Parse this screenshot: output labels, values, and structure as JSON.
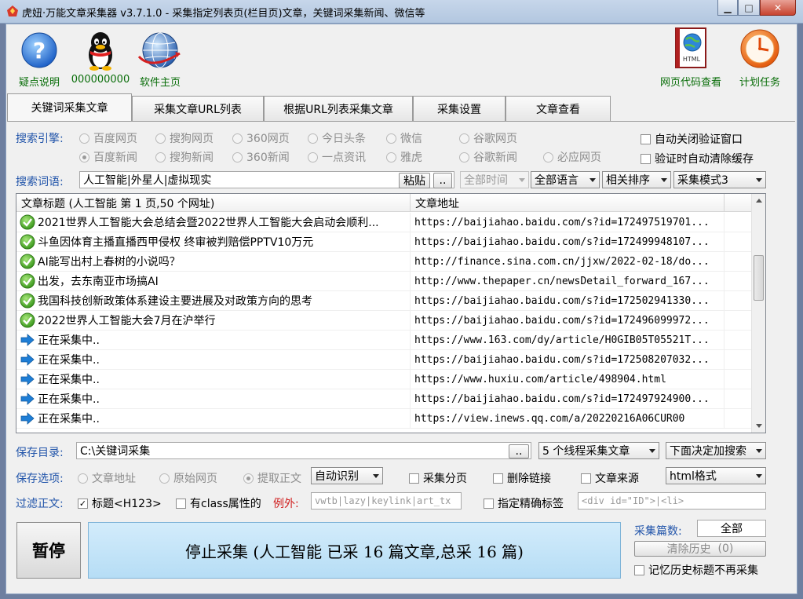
{
  "window": {
    "title": "虎妞·万能文章采集器 v3.7.1.0 - 采集指定列表页(栏目页)文章，关键词采集新闻、微信等"
  },
  "toolbar": {
    "left": [
      {
        "label": "疑点说明",
        "icon": "help-icon"
      },
      {
        "label": "000000000",
        "icon": "qq-penguin-icon"
      },
      {
        "label": "软件主页",
        "icon": "globe-icon"
      }
    ],
    "right": [
      {
        "label": "网页代码查看",
        "icon": "html-file-icon"
      },
      {
        "label": "计划任务",
        "icon": "clock-icon"
      }
    ]
  },
  "tabs": [
    "关键词采集文章",
    "采集文章URL列表",
    "根据URL列表采集文章",
    "采集设置",
    "文章查看"
  ],
  "engines": {
    "label": "搜索引擎:",
    "row1": [
      "百度网页",
      "搜狗网页",
      "360网页",
      "今日头条",
      "微信",
      "谷歌网页"
    ],
    "row2": [
      "百度新闻",
      "搜狗新闻",
      "360新闻",
      "一点资讯",
      "雅虎",
      "谷歌新闻",
      "必应网页"
    ],
    "options": [
      "自动关闭验证窗口",
      "验证时自动清除缓存"
    ]
  },
  "search": {
    "label": "搜索词语:",
    "value": "人工智能|外星人|虚拟现实",
    "paste": "粘贴",
    "more": "..",
    "time": "全部时间",
    "lang": "全部语言",
    "sort": "相关排序",
    "mode": "采集模式3"
  },
  "table": {
    "col_title": "文章标题 (人工智能 第 1 页,50 个网址)",
    "col_url": "文章地址",
    "rows": [
      {
        "status": "done",
        "title": "2021世界人工智能大会总结会暨2022世界人工智能大会启动会顺利...",
        "url": "https://baijiahao.baidu.com/s?id=172497519701..."
      },
      {
        "status": "done",
        "title": "斗鱼因体育主播直播西甲侵权 终审被判赔偿PPTV10万元",
        "url": "https://baijiahao.baidu.com/s?id=172499948107..."
      },
      {
        "status": "done",
        "title": "AI能写出村上春树的小说吗？",
        "url": "http://finance.sina.com.cn/jjxw/2022-02-18/do..."
      },
      {
        "status": "done",
        "title": "出发，去东南亚市场搞AI",
        "url": "http://www.thepaper.cn/newsDetail_forward_167..."
      },
      {
        "status": "done",
        "title": "我国科技创新政策体系建设主要进展及对政策方向的思考",
        "url": "https://baijiahao.baidu.com/s?id=172502941330..."
      },
      {
        "status": "done",
        "title": "2022世界人工智能大会7月在沪举行",
        "url": "https://baijiahao.baidu.com/s?id=172496099972..."
      },
      {
        "status": "pending",
        "title": "正在采集中..",
        "url": "https://www.163.com/dy/article/H0GIB05T05521T..."
      },
      {
        "status": "pending",
        "title": "正在采集中..",
        "url": "https://baijiahao.baidu.com/s?id=172508207032..."
      },
      {
        "status": "pending",
        "title": "正在采集中..",
        "url": "https://www.huxiu.com/article/498904.html"
      },
      {
        "status": "pending",
        "title": "正在采集中..",
        "url": "https://baijiahao.baidu.com/s?id=172497924900..."
      },
      {
        "status": "pending",
        "title": "正在采集中..",
        "url": "https://view.inews.qq.com/a/20220216A06CUR00"
      }
    ]
  },
  "save": {
    "dir_label": "保存目录:",
    "dir_value": "C:\\关键词采集",
    "dir_btn": "..",
    "threads": "5 个线程采集文章",
    "decide": "下面决定加搜索"
  },
  "save_opts": {
    "label": "保存选项:",
    "radios": [
      "文章地址",
      "原始网页",
      "提取正文"
    ],
    "detect": "自动识别",
    "checks": [
      "采集分页",
      "删除链接",
      "文章来源"
    ],
    "format": "html格式"
  },
  "filter": {
    "label": "过滤正文:",
    "title_check": "标题<H123>",
    "class_check": "有class属性的",
    "except_label": "例外:",
    "except_value": "vwtb|lazy|keylink|art_tx",
    "precise_check": "指定精确标签",
    "precise_value": "<div id=\"ID\">|<li>"
  },
  "bottom": {
    "pause": "暂停",
    "status": "停止采集 (人工智能 已采 16 篇文章,总采 16 篇)",
    "count_label": "采集篇数:",
    "count_value": "全部",
    "clear_history": "清除历史",
    "clear_count": "(0)",
    "remember": "记忆历史标题不再采集"
  },
  "colors": {
    "accent_blue": "#2255aa",
    "toolbar_green": "#0a6e0a",
    "status_blue": "#c4e5f8"
  }
}
